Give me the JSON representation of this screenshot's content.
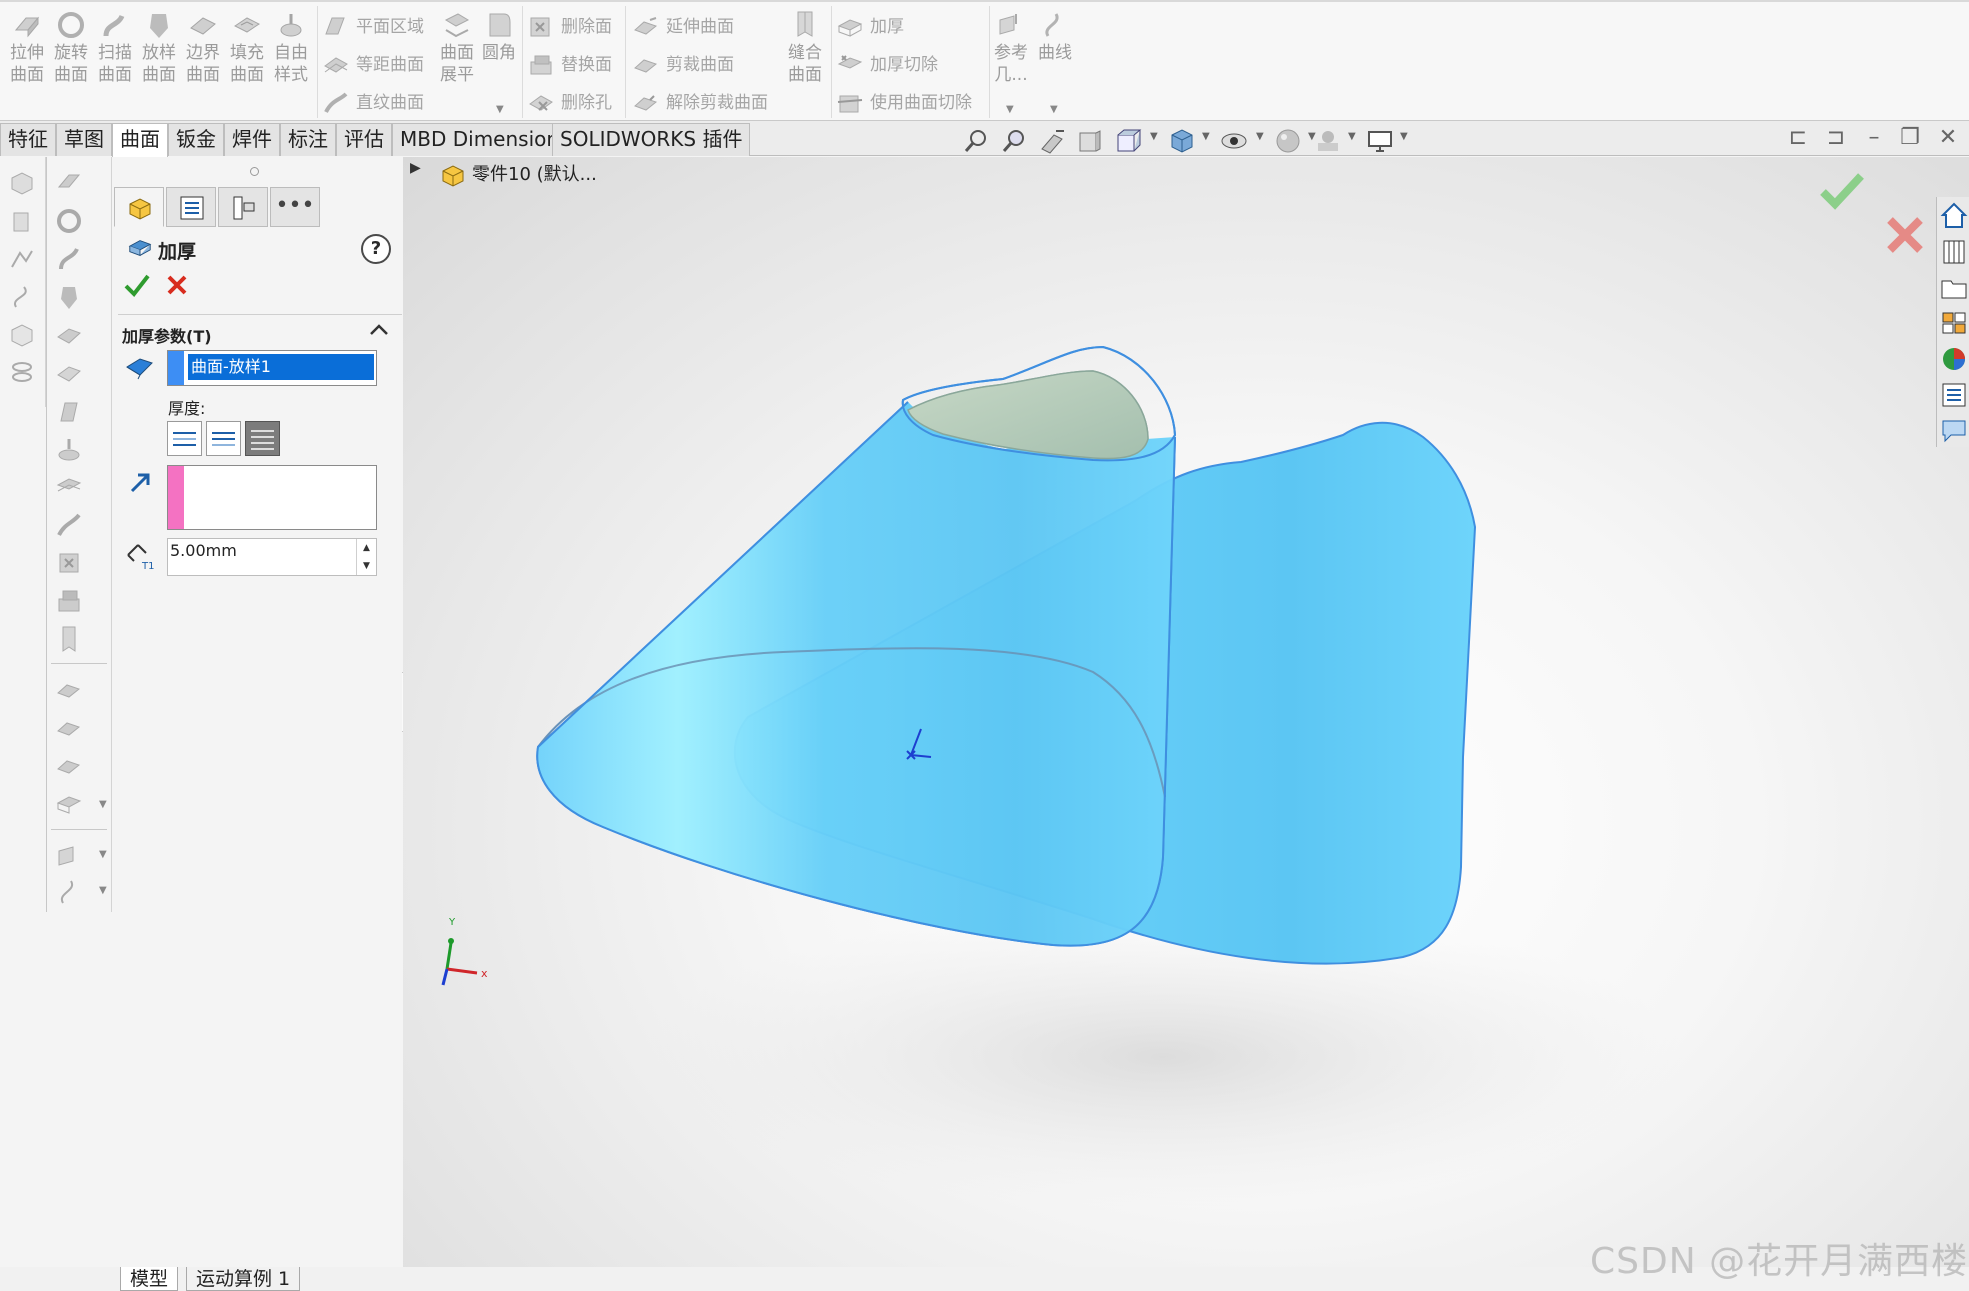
{
  "ribbon": {
    "big_buttons": [
      {
        "label": "拉伸\n曲面",
        "l1": "拉伸",
        "l2": "曲面",
        "icon": "extruded-surface-icon"
      },
      {
        "label": "旋转曲面",
        "l1": "旋转",
        "l2": "曲面",
        "icon": "revolved-surface-icon"
      },
      {
        "label": "扫描曲面",
        "l1": "扫描",
        "l2": "曲面",
        "icon": "swept-surface-icon"
      },
      {
        "label": "放样曲面",
        "l1": "放样",
        "l2": "曲面",
        "icon": "lofted-surface-icon"
      },
      {
        "label": "边界曲面",
        "l1": "边界",
        "l2": "曲面",
        "icon": "boundary-surface-icon"
      },
      {
        "label": "填充曲面",
        "l1": "填充",
        "l2": "曲面",
        "icon": "filled-surface-icon"
      },
      {
        "label": "自由样式",
        "l1": "自由",
        "l2": "样式",
        "icon": "freeform-icon"
      }
    ],
    "group2": {
      "planar": "平面区域",
      "offset": "等距曲面",
      "ruled": "直纹曲面",
      "flatten_l1": "曲面",
      "flatten_l2": "展平",
      "fillet": "圆角"
    },
    "group3": {
      "delete_face": "删除面",
      "replace_face": "替换面",
      "delete_hole": "删除孔"
    },
    "group4": {
      "extend": "延伸曲面",
      "trim": "剪裁曲面",
      "untrim": "解除剪裁曲面",
      "knit_l1": "缝合",
      "knit_l2": "曲面"
    },
    "group5": {
      "thicken": "加厚",
      "thicken_cut": "加厚切除",
      "cut_with_surface": "使用曲面切除"
    },
    "group6": {
      "ref_l1": "参考",
      "ref_l2": "几...",
      "curves": "曲线"
    }
  },
  "tabs": [
    "特征",
    "草图",
    "曲面",
    "钣金",
    "焊件",
    "标注",
    "评估",
    "MBD Dimensions",
    "SOLIDWORKS 插件"
  ],
  "active_tab": "曲面",
  "feature_tree": {
    "node": "零件10 (默认..."
  },
  "property_manager": {
    "title": "加厚",
    "help": "?",
    "section_title": "加厚参数(T)",
    "selected_surface": "曲面-放样1",
    "thickness_label": "厚度:",
    "thickness_value": "5.00mm",
    "t1_label": "T1",
    "spin_up": "▲",
    "spin_down": "▼"
  },
  "triad": {
    "x": "x",
    "y": "Y"
  },
  "bottom_tabs": [
    "模型",
    "运动算例 1"
  ],
  "watermark": "CSDN @花开月满西楼",
  "colors": {
    "surface_fill": "#5fc8f5",
    "surface_edge": "#3f8fe0",
    "selection_blue": "#0a6ed8",
    "direction_pink": "#f472c2",
    "ok_green": "#2e9b2e",
    "cancel_red": "#d82c1e"
  }
}
